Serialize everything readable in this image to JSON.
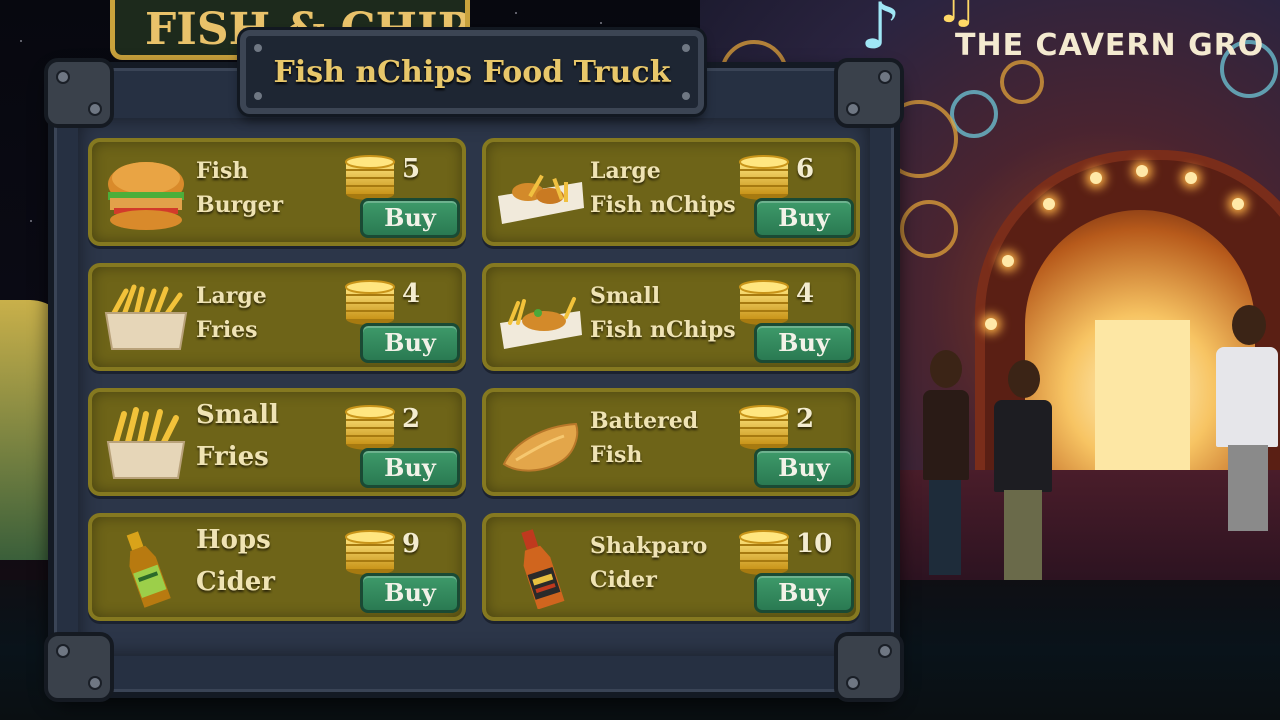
{
  "shop": {
    "title": "Fish nChips Food Truck",
    "buy_label": "Buy",
    "items": [
      {
        "name_line1": "Fish",
        "name_line2": "Burger",
        "price": "5",
        "icon": "fish-burger-icon"
      },
      {
        "name_line1": "Large",
        "name_line2": "Fish nChips",
        "price": "6",
        "icon": "large-fish-n-chips-icon"
      },
      {
        "name_line1": "Large",
        "name_line2": "Fries",
        "price": "4",
        "icon": "large-fries-icon"
      },
      {
        "name_line1": "Small",
        "name_line2": "Fish nChips",
        "price": "4",
        "icon": "small-fish-n-chips-icon"
      },
      {
        "name_line1": "Small",
        "name_line2": "Fries",
        "price": "2",
        "icon": "small-fries-icon"
      },
      {
        "name_line1": "Battered",
        "name_line2": "Fish",
        "price": "2",
        "icon": "battered-fish-icon"
      },
      {
        "name_line1": "Hops",
        "name_line2": "Cider",
        "price": "9",
        "icon": "hops-cider-bottle-icon"
      },
      {
        "name_line1": "Shakparo",
        "name_line2": "Cider",
        "price": "10",
        "icon": "shakparo-cider-bottle-icon"
      }
    ],
    "currency_icon": "gold-coin-stack-icon"
  },
  "scene": {
    "venue_sign": "THE CAVERN GRO",
    "truck_sign": "FISH & CHIPS"
  },
  "colors": {
    "card_bg": "#6e6418",
    "buy_button": "#2f8a5c",
    "title_text": "#e8c76a",
    "panel_frame": "#263042"
  }
}
